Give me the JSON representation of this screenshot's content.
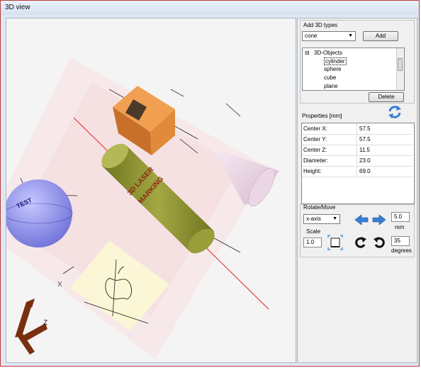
{
  "window": {
    "title": "3D view"
  },
  "viewport": {
    "axis_x_label": "X",
    "axis_z_label": "Z",
    "cylinder_text_line1": "3D LASER",
    "cylinder_text_line2": "MARKING",
    "sphere_text": "TEST"
  },
  "panel": {
    "add_group_label": "Add 3D types",
    "type_select_value": "cone",
    "add_button": "Add",
    "tree": {
      "root": "3D-Objects",
      "root_toggle": "⊟",
      "items": [
        "cylinder",
        "sphere",
        "cube",
        "plane"
      ],
      "selected": "cylinder"
    },
    "delete_button": "Delete",
    "properties_label": "Properties [mm]",
    "properties": [
      {
        "key": "Center X:",
        "value": "57.5"
      },
      {
        "key": "Center Y:",
        "value": "57.5"
      },
      {
        "key": "Center Z:",
        "value": "11.5"
      },
      {
        "key": "Diameter:",
        "value": "23.0"
      },
      {
        "key": "Height:",
        "value": "69.0"
      }
    ],
    "rotate_move_label": "Rotate/Move",
    "axis_select_value": "x-axis",
    "move_step": "5.0",
    "move_unit": "mm",
    "scale_label": "Scale",
    "scale_value": "1.0",
    "rotate_step": "35",
    "rotate_unit": "degrees"
  },
  "colors": {
    "accent_blue": "#3a7fd5",
    "cube": "#e08a3a",
    "cylinder": "#8b8f2e",
    "sphere": "#8d8ff0",
    "cone": "#e8d2e2",
    "axis_red": "#e02020"
  },
  "icons": {
    "refresh": "refresh-icon",
    "move_left": "arrow-left-icon",
    "move_right": "arrow-right-icon",
    "rotate_cw": "rotate-cw-icon",
    "rotate_ccw": "rotate-ccw-icon",
    "fit": "fit-view-icon",
    "axes": "axes-gizmo-icon"
  }
}
